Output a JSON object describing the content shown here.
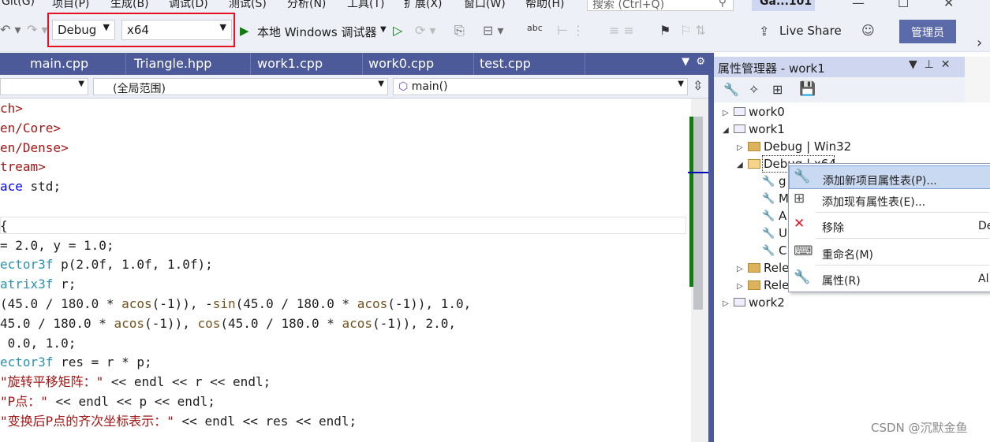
{
  "menu": [
    "Git(G)",
    "项目(P)",
    "生成(B)",
    "调试(D)",
    "测试(S)",
    "分析(N)",
    "工具(T)",
    "扩展(X)",
    "窗口(W)",
    "帮助(H)"
  ],
  "search": {
    "placeholder": "搜索 (Ctrl+Q)"
  },
  "solution_name": "Ga...101",
  "toolbar": {
    "config": "Debug",
    "platform": "x64",
    "run_label": "本地 Windows 调试器",
    "live_share": "Live Share",
    "admin": "管理员"
  },
  "tabs": [
    "main.cpp",
    "Triangle.hpp",
    "work1.cpp",
    "work0.cpp",
    "test.cpp"
  ],
  "navbar": {
    "scope": "(全局范围)",
    "member": "main()"
  },
  "code_lines": [
    {
      "text": "ch>",
      "cls": "inc"
    },
    {
      "text": "en/Core>",
      "cls": "inc"
    },
    {
      "text": "en/Dense>",
      "cls": "inc"
    },
    {
      "text": "tream>",
      "cls": "inc"
    },
    {
      "text": "ace std;",
      "cls": "mix1"
    },
    {
      "text": "",
      "cls": "nm"
    },
    {
      "text": "{",
      "cls": "nm"
    },
    {
      "text": "= 2.0, y = 1.0;",
      "cls": "nm"
    },
    {
      "text": "ector3f p(2.0f, 1.0f, 1.0f);",
      "cls": "mix2"
    },
    {
      "text": "atrix3f r;",
      "cls": "mix3"
    },
    {
      "text": "(45.0 / 180.0 * acos(-1)), -sin(45.0 / 180.0 * acos(-1)), 1.0,",
      "cls": "mix4"
    },
    {
      "text": "45.0 / 180.0 * acos(-1)), cos(45.0 / 180.0 * acos(-1)), 2.0,",
      "cls": "mix5"
    },
    {
      "text": " 0.0, 1.0;",
      "cls": "nm"
    },
    {
      "text": "ector3f res = r * p;",
      "cls": "mix6"
    },
    {
      "text": "\"旋转平移矩阵：\" << endl << r << endl;",
      "cls": "mix7"
    },
    {
      "text": "\"P点：\" << endl << p << endl;",
      "cls": "mix7"
    },
    {
      "text": "\"变换后P点的齐次坐标表示：\" << endl << res << endl;",
      "cls": "mix7"
    }
  ],
  "property_manager": {
    "title": "属性管理器 - work1",
    "tree": [
      {
        "label": "work0"
      },
      {
        "label": "work1"
      },
      {
        "label": "Debug | Win32"
      },
      {
        "label": "Debug | x64"
      },
      {
        "label": "g"
      },
      {
        "label": "M"
      },
      {
        "label": "A"
      },
      {
        "label": "U"
      },
      {
        "label": "C"
      },
      {
        "label": "Rele"
      },
      {
        "label": "Rele"
      },
      {
        "label": "work2"
      }
    ]
  },
  "context_menu": [
    {
      "label": "添加新项目属性表(P)...",
      "shortcut": ""
    },
    {
      "label": "添加现有属性表(E)...",
      "shortcut": ""
    },
    {
      "label": "移除",
      "shortcut": "De"
    },
    {
      "label": "重命名(M)",
      "shortcut": ""
    },
    {
      "label": "属性(R)",
      "shortcut": "Al"
    }
  ],
  "watermark": "CSDN @沉默金鱼",
  "colors": {
    "tab_bar": "#4d5a99",
    "highlight_box": "#e81123",
    "green_margin": "#107c10"
  }
}
